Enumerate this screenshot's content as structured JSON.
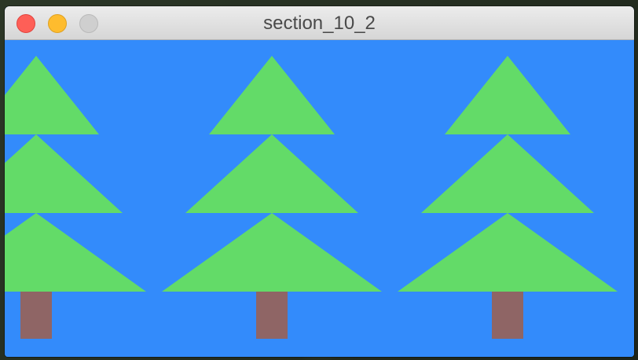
{
  "window": {
    "title": "section_10_2",
    "traffic_lights": {
      "close": {
        "icon": "close-dot-icon",
        "color": "#fe5f57"
      },
      "minimize": {
        "icon": "minimize-dot-icon",
        "color": "#febc2e"
      },
      "zoom": {
        "icon": "zoom-dot-icon",
        "color": "#cfcfcf"
      }
    }
  },
  "scene": {
    "background_color": "#338bfb",
    "foliage_color": "#63db68",
    "trunk_color": "#8f6565",
    "tree_count": 3
  }
}
